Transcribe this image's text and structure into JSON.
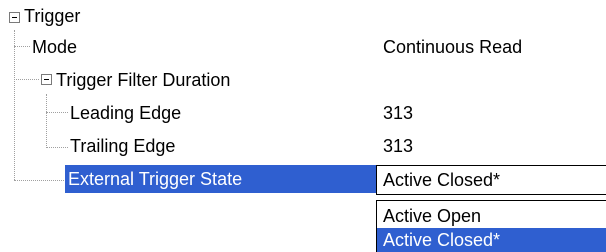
{
  "tree": {
    "root": {
      "label": "Trigger"
    },
    "mode": {
      "label": "Mode",
      "value": "Continuous Read"
    },
    "filter": {
      "label": "Trigger Filter Duration"
    },
    "leading": {
      "label": "Leading Edge",
      "value": "313"
    },
    "trailing": {
      "label": "Trailing Edge",
      "value": "313"
    },
    "external": {
      "label": "External Trigger State",
      "value": "Active Closed*"
    }
  },
  "dropdown": {
    "options": [
      "Active Open",
      "Active Closed*"
    ],
    "selected": "Active Closed*"
  },
  "colors": {
    "selection": "#2f5fd0",
    "tree_lines": "#a0a0a0"
  },
  "icons": [
    "collapse-icon"
  ]
}
